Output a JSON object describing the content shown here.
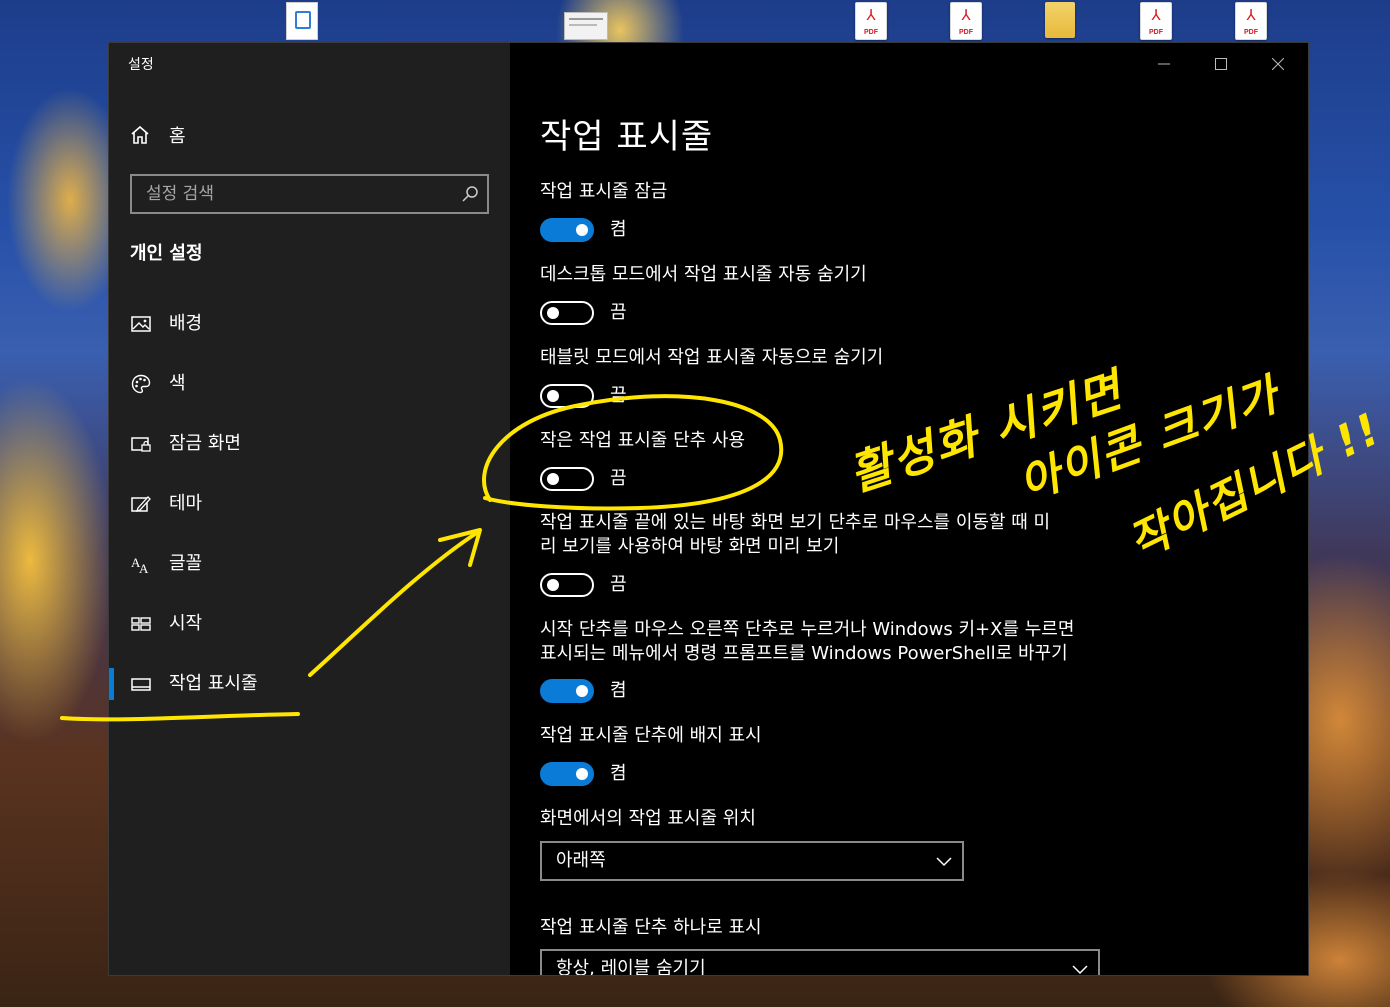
{
  "window": {
    "app_title": "설정",
    "controls": {
      "minimize_icon": "minimize-icon",
      "maximize_icon": "maximize-icon",
      "close_icon": "close-icon"
    }
  },
  "sidebar": {
    "home_label": "홈",
    "search_placeholder": "설정 검색",
    "group_header": "개인 설정",
    "items": [
      {
        "label": "배경",
        "icon": "picture-icon"
      },
      {
        "label": "색",
        "icon": "palette-icon"
      },
      {
        "label": "잠금 화면",
        "icon": "lock-screen-icon"
      },
      {
        "label": "테마",
        "icon": "theme-icon"
      },
      {
        "label": "글꼴",
        "icon": "font-icon"
      },
      {
        "label": "시작",
        "icon": "start-icon"
      },
      {
        "label": "작업 표시줄",
        "icon": "taskbar-icon",
        "active": true
      }
    ],
    "accent_color": "#0a7bd6"
  },
  "main": {
    "title": "작업 표시줄",
    "settings": [
      {
        "label": "작업 표시줄 잠금",
        "state": "켬",
        "on": true
      },
      {
        "label": "데스크톱 모드에서 작업 표시줄 자동 숨기기",
        "state": "끔",
        "on": false
      },
      {
        "label": "태블릿 모드에서 작업 표시줄 자동으로 숨기기",
        "state": "끔",
        "on": false
      },
      {
        "label": "작은 작업 표시줄 단추 사용",
        "state": "끔",
        "on": false
      },
      {
        "label_line1": "작업 표시줄 끝에 있는 바탕 화면 보기 단추로 마우스를 이동할 때 미",
        "label_line2": "리 보기를 사용하여 바탕 화면 미리 보기",
        "state": "끔",
        "on": false
      },
      {
        "label_line1": "시작 단추를 마우스 오른쪽 단추로 누르거나 Windows 키+X를 누르면",
        "label_line2": "표시되는 메뉴에서 명령 프롬프트를 Windows PowerShell로 바꾸기",
        "state": "켬",
        "on": true
      },
      {
        "label": "작업 표시줄 단추에 배지 표시",
        "state": "켬",
        "on": true
      }
    ],
    "position": {
      "label": "화면에서의 작업 표시줄 위치",
      "value": "아래쪽"
    },
    "combine": {
      "label": "작업 표시줄 단추 하나로 표시",
      "value": "항상, 레이블 숨기기"
    }
  },
  "desktop": {
    "pdf_label": "PDF",
    "icons": [
      "document-icon",
      "thumbnail-icon",
      "pdf-icon",
      "pdf-icon",
      "folder-icon",
      "pdf-icon",
      "pdf-icon"
    ]
  },
  "annotations": {
    "line1": "활성화 시키면",
    "line2": "아이콘 크기가",
    "line3": "작아집니다 !!",
    "color": "#ffe600"
  }
}
